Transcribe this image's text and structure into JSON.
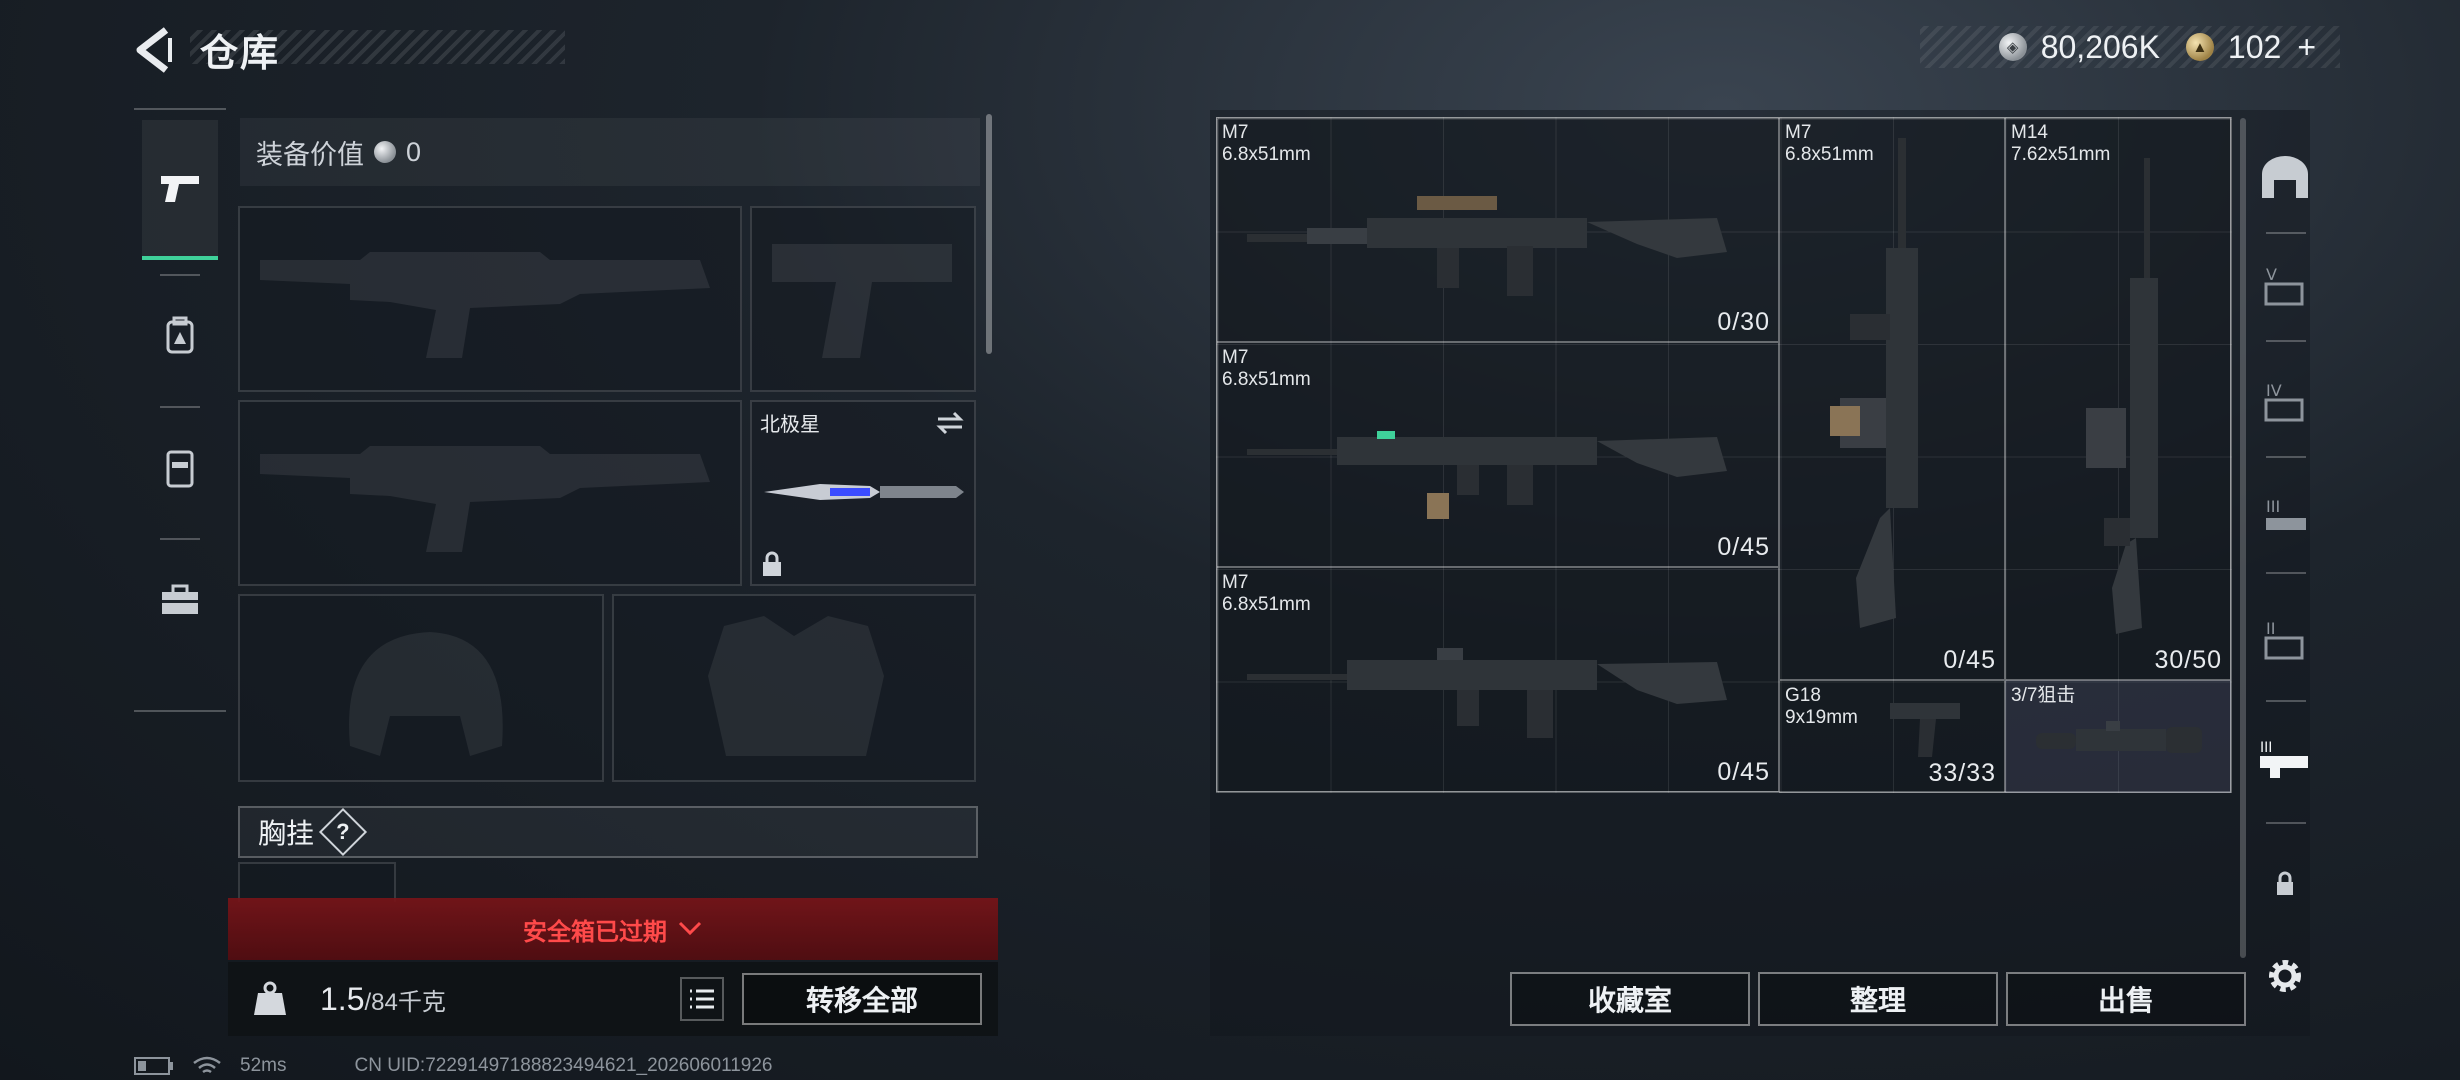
{
  "header": {
    "title": "仓库"
  },
  "currency": {
    "silver_value": "80,206K",
    "gold_value": "102",
    "gold_plus": "+"
  },
  "loadout": {
    "equip_value_label": "装备价值",
    "equip_value": "0",
    "melee_label": "北极星",
    "chest_rig_label": "胸挂",
    "chest_rig_help": "?",
    "safebox_status": "安全箱已过期",
    "weight_current": "1.5",
    "weight_max": "/84千克",
    "transfer_all_label": "转移全部"
  },
  "storage": {
    "items": [
      {
        "name": "M7",
        "caliber": "6.8x51mm",
        "count": "0/30"
      },
      {
        "name": "M7",
        "caliber": "6.8x51mm",
        "count": "0/45"
      },
      {
        "name": "M7",
        "caliber": "6.8x51mm",
        "count": "0/45"
      },
      {
        "name": "M7",
        "caliber": "6.8x51mm",
        "count": "0/45"
      },
      {
        "name": "M14",
        "caliber": "7.62x51mm",
        "count": "30/50"
      },
      {
        "name": "G18",
        "caliber": "9x19mm",
        "count": "33/33"
      },
      {
        "name": "3/7狙击",
        "caliber": "",
        "count": ""
      }
    ],
    "buttons": {
      "collection": "收藏室",
      "organize": "整理",
      "sell": "出售"
    }
  },
  "status_bar": {
    "ping": "52ms",
    "uid": "CN UID:72291497188823494621_202606011926"
  },
  "colors": {
    "accent_green": "#3fd19a",
    "warning_red": "#ff4a4a",
    "banner_red": "#7a1418"
  }
}
